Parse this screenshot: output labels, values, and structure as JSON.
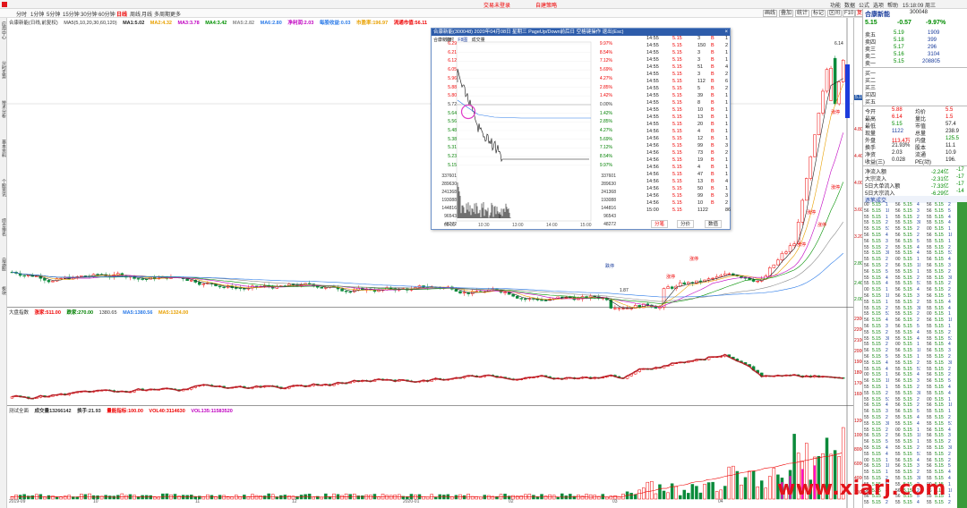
{
  "app": {
    "title_items": [
      "交易未登录",
      "自建策略"
    ],
    "menu_right": [
      "功能",
      "数据",
      "公式",
      "选项",
      "帮助"
    ],
    "time": "15:18:09 周三"
  },
  "toolbar": {
    "periods": [
      "分时",
      "1分钟",
      "5分钟",
      "15分钟",
      "30分钟",
      "60分钟",
      "日线",
      "周线",
      "月线",
      "多周期",
      "更多"
    ],
    "buttons": [
      "画线",
      "叠加",
      "统计",
      "标记",
      "区间",
      "F10",
      "复权"
    ],
    "active": "日线"
  },
  "leftbar": {
    "tabs": [
      "应用中心",
      "分时走势",
      "技术分析",
      "基本资料",
      "个股资讯",
      "综合排名",
      "自选股",
      "板块"
    ]
  },
  "kline": {
    "title": "合康新能(日线,前复权)",
    "ma": [
      {
        "label": "MA5(5,10,20,30,60,120)",
        "color": "#222"
      },
      {
        "label": "MA1:",
        "value": "5.02",
        "color": "#222"
      },
      {
        "label": "MA2:",
        "value": "4.32",
        "color": "#e8a000"
      },
      {
        "label": "MA3:",
        "value": "3.78",
        "color": "#c000c0"
      },
      {
        "label": "MA4:",
        "value": "3.42",
        "color": "#009000"
      },
      {
        "label": "MA5:",
        "value": "2.82",
        "color": "#888"
      },
      {
        "label": "MA6:",
        "value": "2.80",
        "color": "#2a7ae8"
      }
    ],
    "extra": [
      {
        "label": "净利润:",
        "value": "2.03",
        "color": "#c000c0"
      },
      {
        "label": "每股收益:",
        "value": "0.03",
        "color": "#2a7ae8"
      },
      {
        "label": "市盈率:",
        "value": "196.97",
        "color": "#e8a000"
      },
      {
        "label": "流通市值:",
        "value": "56.11",
        "color": "#e00"
      }
    ],
    "high_label": "6.14",
    "low_label": "1.87",
    "markers": [
      {
        "t": "涨停"
      },
      {
        "t": "跌停"
      },
      {
        "t": "涨停"
      },
      {
        "t": "涨停"
      },
      {
        "t": "涨停"
      },
      {
        "t": "涨停"
      },
      {
        "t": "涨停"
      },
      {
        "t": "涨停"
      }
    ]
  },
  "index": {
    "title": "大盘指数",
    "info": [
      {
        "label": "涨家:",
        "value": "511.00",
        "color": "#e00"
      },
      {
        "label": "跌家:",
        "value": "270.00",
        "color": "#008000"
      },
      {
        "label": "",
        "value": "1380.65",
        "color": "#222"
      },
      {
        "label": "MA5:",
        "value": "1380.56",
        "color": "#2a7ae8"
      },
      {
        "label": "MA5:",
        "value": "1324.00",
        "color": "#e8a000"
      }
    ]
  },
  "volume": {
    "title": "测试全面",
    "info": [
      {
        "label": "成交量",
        "value": "13266142",
        "color": "#222"
      },
      {
        "label": "换手:",
        "value": "21.93",
        "color": "#222"
      },
      {
        "label": "量能指标:",
        "value": "100.00",
        "color": "#e00"
      },
      {
        "label": "VOL40:",
        "value": "3114630",
        "color": "#e00"
      },
      {
        "label": "VOL135:",
        "value": "11583520",
        "color": "#c000c0"
      }
    ]
  },
  "axis": {
    "price_ticks": [
      "5.15",
      "4.80",
      "4.40",
      "4.00",
      "3.60",
      "3.20",
      "2.80",
      "2.40",
      "2.00",
      "1.80"
    ],
    "index_ticks": [
      "2300",
      "2200",
      "2100",
      "2000",
      "1900",
      "1800",
      "1700",
      "1600"
    ],
    "vol_ticks": [
      "12000",
      "10000",
      "8000",
      "6000",
      "4000",
      "2000"
    ],
    "date_labels": [
      "2019-09",
      "10",
      "11",
      "12",
      "2020-01",
      "02",
      "03",
      "04"
    ]
  },
  "popup": {
    "title": "合康新能(300048) 2020年04月08日 星期三 PageUp/Down前后日 空格键操作 退出(Esc)",
    "tabs": [
      "分时",
      "F8图",
      "成交量"
    ],
    "price_left": [
      "6.29",
      "6.21",
      "6.12",
      "6.05",
      "5.96",
      "5.88",
      "5.80",
      "5.72",
      "5.64",
      "5.56",
      "5.48",
      "5.38",
      "5.31",
      "5.23",
      "5.15"
    ],
    "pct_right": [
      "9.97%",
      "8.54%",
      "7.12%",
      "5.69%",
      "4.27%",
      "2.85%",
      "1.42%",
      "0.00%",
      "1.42%",
      "2.85%",
      "4.27%",
      "5.69%",
      "7.12%",
      "8.54%",
      "9.97%"
    ],
    "vol_left": [
      "337601",
      "289630",
      "241368",
      "193088",
      "144816",
      "96543",
      "48272"
    ],
    "time_axis": [
      "09:30",
      "10:30",
      "13:00",
      "14:00",
      "15:00"
    ],
    "buttons": [
      "分笔",
      "分价",
      "数值"
    ],
    "trades": [
      [
        "14:55",
        "5.15",
        "3",
        "B",
        "1"
      ],
      [
        "14:55",
        "5.15",
        "150",
        "B",
        "2"
      ],
      [
        "14:55",
        "5.15",
        "3",
        "B",
        "1"
      ],
      [
        "14:55",
        "5.15",
        "3",
        "B",
        "1"
      ],
      [
        "14:55",
        "5.15",
        "51",
        "B",
        "4"
      ],
      [
        "14:55",
        "5.15",
        "3",
        "B",
        "2"
      ],
      [
        "14:55",
        "5.15",
        "112",
        "B",
        "6"
      ],
      [
        "14:55",
        "5.15",
        "5",
        "B",
        "2"
      ],
      [
        "14:55",
        "5.15",
        "39",
        "B",
        "1"
      ],
      [
        "14:55",
        "5.15",
        "8",
        "B",
        "1"
      ],
      [
        "14:55",
        "5.15",
        "10",
        "B",
        "1"
      ],
      [
        "14:55",
        "5.15",
        "13",
        "B",
        "1"
      ],
      [
        "14:55",
        "5.15",
        "20",
        "B",
        "1"
      ],
      [
        "14:56",
        "5.15",
        "4",
        "B",
        "1"
      ],
      [
        "14:56",
        "5.15",
        "12",
        "B",
        "1"
      ],
      [
        "14:56",
        "5.15",
        "99",
        "B",
        "3"
      ],
      [
        "14:56",
        "5.15",
        "73",
        "B",
        "2"
      ],
      [
        "14:56",
        "5.15",
        "19",
        "B",
        "1"
      ],
      [
        "14:56",
        "5.15",
        "4",
        "B",
        "1"
      ],
      [
        "14:56",
        "5.15",
        "47",
        "B",
        "1"
      ],
      [
        "14:56",
        "5.15",
        "13",
        "B",
        "4"
      ],
      [
        "14:56",
        "5.15",
        "50",
        "B",
        "1"
      ],
      [
        "14:56",
        "5.15",
        "99",
        "B",
        "3"
      ],
      [
        "14:56",
        "5.15",
        "10",
        "B",
        "2"
      ],
      [
        "15:00",
        "5.15",
        "1122",
        "",
        "86"
      ]
    ]
  },
  "quote": {
    "name": "合康新能",
    "code": "300048",
    "price": "5.15",
    "change": "-0.57",
    "pct": "-9.97%",
    "asks": [
      [
        "卖五",
        "5.19",
        "1909"
      ],
      [
        "卖四",
        "5.18",
        "399"
      ],
      [
        "卖三",
        "5.17",
        "296"
      ],
      [
        "卖二",
        "5.16",
        "3104"
      ],
      [
        "卖一",
        "5.15",
        "208805"
      ]
    ],
    "bids": [
      [
        "买一",
        ""
      ],
      [
        "买二",
        ""
      ],
      [
        "买三",
        ""
      ],
      [
        "买四",
        ""
      ],
      [
        "买五",
        ""
      ]
    ],
    "stats": [
      [
        "今开",
        "5.88",
        "均价",
        "5.5"
      ],
      [
        "最高",
        "6.14",
        "量比",
        "1.5"
      ],
      [
        "最低",
        "5.15",
        "市值",
        "57.4"
      ],
      [
        "现量",
        "1122",
        "总量",
        "238.9"
      ],
      [
        "外盘",
        "113.4万",
        "内盘",
        "125.5"
      ],
      [
        "换手",
        "21.93%",
        "股本",
        "11.1"
      ],
      [
        "净资",
        "2.03",
        "流通",
        "10.9"
      ],
      [
        "收益(三)",
        "0.028",
        "PE(动)",
        "196."
      ]
    ],
    "flows": [
      [
        "净流入额",
        "-2.24亿",
        "-17"
      ],
      [
        "大宗流入",
        "-2.31亿",
        "-17"
      ],
      [
        "5日大单流入额",
        "-7.33亿",
        "-17"
      ],
      [
        "5日大宗流入",
        "-6.29亿",
        "-14"
      ]
    ],
    "ticks_title": "逐笔成交",
    "ticks_first": "15:00:00"
  },
  "tick_cells": [
    [
      "15:00",
      "5.15",
      "1"
    ],
    [
      "14:56",
      "5.15",
      "4"
    ],
    [
      "14:56",
      "5.15",
      "2"
    ],
    [
      "14:56",
      "5.15",
      "10"
    ],
    [
      "14:56",
      "5.15",
      "3"
    ],
    [
      "14:56",
      "5.15",
      "5"
    ],
    [
      "14:55",
      "5.15",
      "1"
    ],
    [
      "14:55",
      "5.15",
      "2"
    ],
    [
      "14:55",
      "5.15",
      "4"
    ],
    [
      "14:55",
      "5.15",
      "2"
    ],
    [
      "14:55",
      "5.15",
      "30"
    ],
    [
      "14:55",
      "5.15",
      "4"
    ],
    [
      "14:55",
      "5.15",
      "51"
    ],
    [
      "14:55",
      "5.15",
      "2"
    ]
  ],
  "watermark": "www.xiarj.com"
}
